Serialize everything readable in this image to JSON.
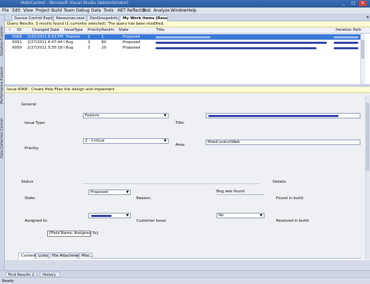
{
  "window": {
    "title": "MobiControl - Microsoft Visual Studio (Administrator)",
    "min": "_",
    "max": "□",
    "close": "✕"
  },
  "menu": [
    "File",
    "Edit",
    "View",
    "Project",
    "Build",
    "Team",
    "Debug",
    "Data",
    "Tools",
    ".NET Reflector",
    "Test",
    "Analyze",
    "Window",
    "Help"
  ],
  "doc_tabs": [
    "Source Control Explorer",
    "Resources.resx",
    "DevGroupsInfo.js",
    "My Work Items [Results]"
  ],
  "doc_tab_close": "✕",
  "left_dock": [
    "Solution Explorer",
    "Performance Explorer",
    "Data Collection Control"
  ],
  "query": {
    "status": "Query Results: 3 results found (1 currently selected). The query has been modified.",
    "columns": [
      "ID",
      "Changed Date",
      "IssueType",
      "Priority",
      "RankIn",
      "State",
      "Title",
      "Iteration Path"
    ],
    "rows": [
      {
        "id": "6068",
        "date": "2/25/2011 6:53 PM",
        "type": "Feature",
        "priority": "2",
        "rank": "1",
        "state": "Proposed"
      },
      {
        "id": "6051",
        "date": "2/27/2011 6:47:44 PM",
        "type": "Bug",
        "priority": "3",
        "rank": "80",
        "state": "Proposed"
      },
      {
        "id": "6050",
        "date": "2/27/2011 5:35:18 PM",
        "type": "Bug",
        "priority": "3",
        "rank": "20",
        "state": "Proposed"
      }
    ]
  },
  "work_item": {
    "title": "Issue 6068 : Create Help Files link design and implement",
    "general": "General",
    "issue_type_label": "Issue Type:",
    "issue_type": "Feature",
    "priority_label": "Priority:",
    "priority": "2 - Critical",
    "title_label": "Title:",
    "area_label": "Area:",
    "area": "MobiControl\\Web",
    "status": "Status",
    "details": "Details",
    "state_label": "State:",
    "state": "Proposed",
    "reason_label": "Reason:",
    "reason": "Bug was found",
    "found_in_build_label": "Found in build:",
    "assigned_to_label": "Assigned to:",
    "customer_issue_label": "Customer Issue:",
    "customer_issue": "No",
    "resolved_in_build_label": "Resolved in build:",
    "tooltip": "[Field Name: Assigned To]",
    "tabs": [
      "Content",
      "Links",
      "File Attachments",
      "Misc..."
    ]
  },
  "bottom_tabs": [
    "Find Results 2",
    "History"
  ],
  "status_bar": "Ready",
  "colors": {
    "selection": "#3a78d6",
    "redaction": "#2f3fa6",
    "query_bar": "#fffbd2"
  }
}
